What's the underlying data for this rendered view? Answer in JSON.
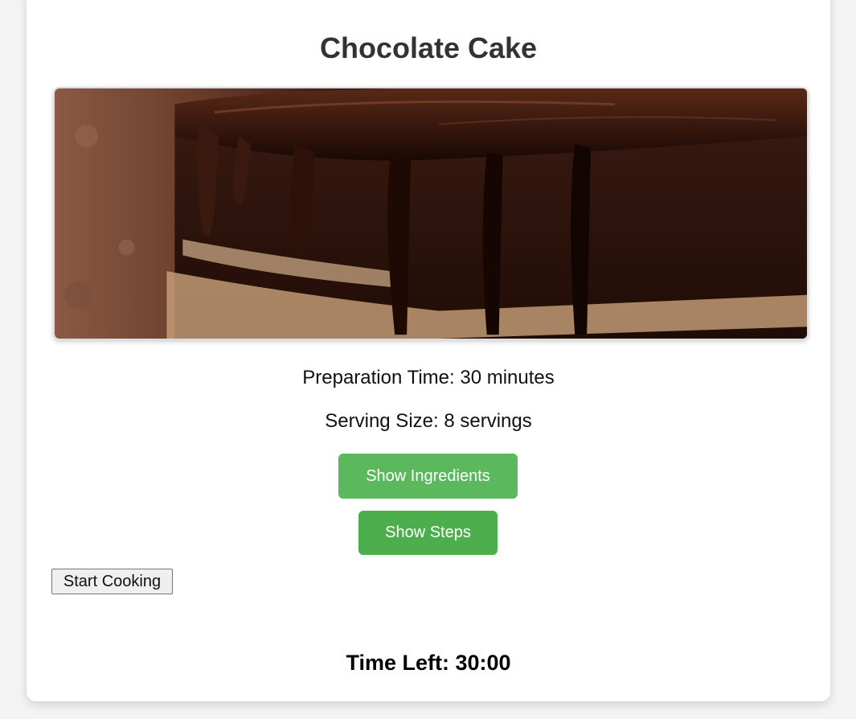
{
  "recipe": {
    "title": "Chocolate Cake",
    "prep_time": "Preparation Time: 30 minutes",
    "serving_size": "Serving Size: 8 servings"
  },
  "buttons": {
    "show_ingredients": "Show Ingredients",
    "show_steps": "Show Steps",
    "start_cooking": "Start Cooking"
  },
  "timer": {
    "label": "Time Left: 30:00"
  },
  "colors": {
    "accent_green": "#5cb85c",
    "title_text": "#333333",
    "page_bg": "#f4f4f4"
  },
  "image": {
    "subject": "chocolate-cake-photo"
  }
}
